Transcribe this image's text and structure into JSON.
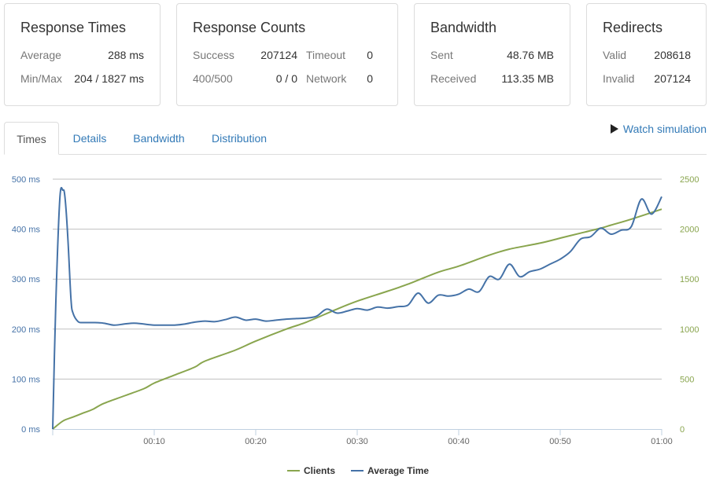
{
  "cards": {
    "response_times": {
      "title": "Response Times",
      "average_label": "Average",
      "average_value": "288 ms",
      "minmax_label": "Min/Max",
      "minmax_value": "204 / 1827 ms"
    },
    "response_counts": {
      "title": "Response Counts",
      "success_label": "Success",
      "success_value": "207124",
      "timeout_label": "Timeout",
      "timeout_value": "0",
      "err_label": "400/500",
      "err_value": "0 / 0",
      "network_label": "Network",
      "network_value": "0"
    },
    "bandwidth": {
      "title": "Bandwidth",
      "sent_label": "Sent",
      "sent_value": "48.76 MB",
      "received_label": "Received",
      "received_value": "113.35 MB"
    },
    "redirects": {
      "title": "Redirects",
      "valid_label": "Valid",
      "valid_value": "208618",
      "invalid_label": "Invalid",
      "invalid_value": "207124"
    }
  },
  "tabs": [
    {
      "label": "Times",
      "active": true
    },
    {
      "label": "Details",
      "active": false
    },
    {
      "label": "Bandwidth",
      "active": false
    },
    {
      "label": "Distribution",
      "active": false
    }
  ],
  "watch_simulation": {
    "label": "Watch simulation",
    "icon": "play-icon"
  },
  "colors": {
    "average_time": "#4572a7",
    "clients": "#89a54e",
    "grid": "#c0c0c0",
    "left_axis": "#4572a7",
    "right_axis": "#89a54e",
    "link": "#337ab7"
  },
  "chart_data": {
    "type": "line",
    "grid": true,
    "legend": "bottom-center",
    "x_ticks": [
      "00:10",
      "00:20",
      "00:30",
      "00:40",
      "00:50",
      "01:00"
    ],
    "x_tick_seconds": [
      10,
      20,
      30,
      40,
      50,
      60
    ],
    "xlim": [
      0,
      60
    ],
    "y_left": {
      "ticks": [
        "0 ms",
        "100 ms",
        "200 ms",
        "300 ms",
        "400 ms",
        "500 ms"
      ],
      "tick_values": [
        0,
        100,
        200,
        300,
        400,
        500
      ],
      "ylim": [
        0,
        500
      ]
    },
    "y_right": {
      "ticks": [
        "0",
        "500",
        "1000",
        "1500",
        "2000",
        "2500"
      ],
      "tick_values": [
        0,
        500,
        1000,
        1500,
        2000,
        2500
      ],
      "ylim": [
        0,
        2500
      ]
    },
    "series": [
      {
        "name": "Clients",
        "axis": "right",
        "x": [
          0,
          1,
          2,
          3,
          4,
          5,
          7,
          9,
          10,
          12,
          14,
          15,
          18,
          20,
          23,
          25,
          28,
          30,
          33,
          35,
          38,
          40,
          43,
          45,
          48,
          50,
          52,
          54,
          55,
          57,
          60
        ],
        "y": [
          0,
          80,
          120,
          160,
          200,
          255,
          330,
          405,
          460,
          540,
          620,
          680,
          790,
          880,
          1000,
          1070,
          1200,
          1280,
          1380,
          1450,
          1570,
          1630,
          1740,
          1800,
          1860,
          1910,
          1960,
          2010,
          2040,
          2100,
          2200
        ]
      },
      {
        "name": "Average Time",
        "axis": "left",
        "x": [
          0,
          0.3,
          0.7,
          1.0,
          1.2,
          1.5,
          1.8,
          2.0,
          2.5,
          3,
          4,
          5,
          6,
          7,
          8,
          9,
          10,
          11,
          12,
          13,
          14,
          15,
          16,
          17,
          18,
          19,
          20,
          21,
          22,
          23,
          24,
          25,
          26,
          27,
          28,
          29,
          30,
          31,
          32,
          33,
          34,
          35,
          36,
          37,
          38,
          39,
          40,
          41,
          42,
          43,
          44,
          45,
          46,
          47,
          48,
          49,
          50,
          51,
          52,
          53,
          54,
          55,
          56,
          57,
          58,
          59,
          60
        ],
        "y": [
          0,
          250,
          460,
          478,
          465,
          380,
          260,
          232,
          215,
          213,
          213,
          212,
          208,
          210,
          212,
          210,
          208,
          208,
          208,
          210,
          214,
          216,
          215,
          219,
          224,
          218,
          220,
          216,
          218,
          220,
          221,
          222,
          226,
          240,
          232,
          236,
          241,
          238,
          244,
          242,
          245,
          248,
          272,
          252,
          268,
          266,
          270,
          280,
          275,
          305,
          300,
          330,
          305,
          315,
          320,
          330,
          340,
          355,
          380,
          385,
          402,
          390,
          398,
          405,
          460,
          430,
          465
        ]
      }
    ]
  }
}
